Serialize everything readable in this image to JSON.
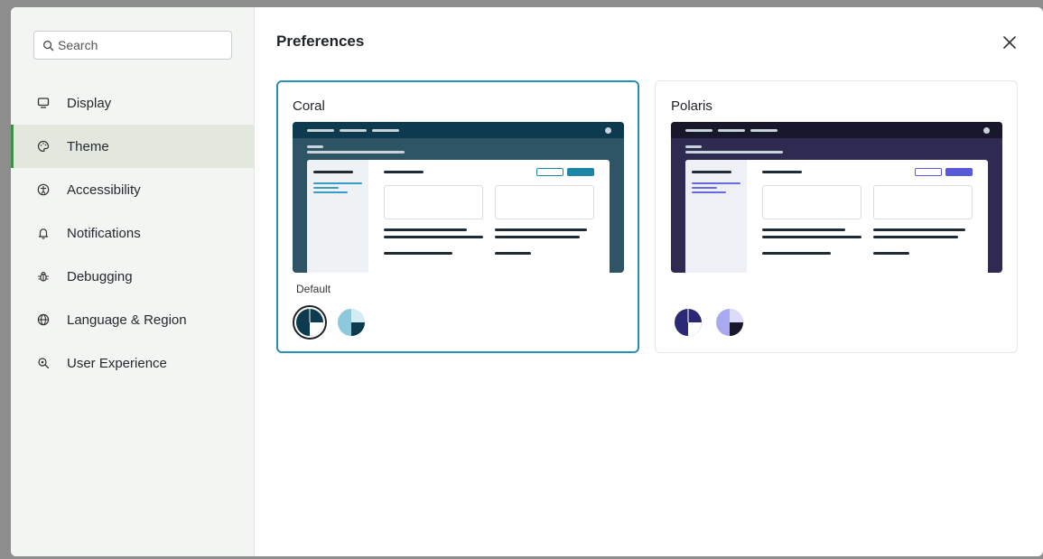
{
  "search": {
    "placeholder": "Search"
  },
  "sidebar": {
    "items": [
      {
        "label": "Display",
        "icon": "monitor-icon"
      },
      {
        "label": "Theme",
        "icon": "palette-icon",
        "active": true
      },
      {
        "label": "Accessibility",
        "icon": "accessibility-icon"
      },
      {
        "label": "Notifications",
        "icon": "bell-icon"
      },
      {
        "label": "Debugging",
        "icon": "bug-icon"
      },
      {
        "label": "Language & Region",
        "icon": "globe-icon"
      },
      {
        "label": "User Experience",
        "icon": "user-experience-icon"
      }
    ]
  },
  "main": {
    "title": "Preferences",
    "close_icon": "close-icon",
    "themes": [
      {
        "name": "Coral",
        "selected": true,
        "default_label": "Default",
        "colors": {
          "header": "#0d3a4f",
          "body": "#2d5566",
          "accent": "#1b86a6",
          "side": "#eef2f4",
          "link": "#3a9cc4"
        },
        "swatches": [
          "dark",
          "light"
        ],
        "active_swatch": "dark"
      },
      {
        "name": "Polaris",
        "selected": false,
        "colors": {
          "header": "#19172c",
          "body": "#2f2a52",
          "accent": "#5a5ad8",
          "side": "#eff0f6",
          "link": "#6a6ae0"
        },
        "swatches": [
          "dark",
          "light"
        ]
      }
    ]
  },
  "colors": {
    "sidebar_active_accent": "#3f8f4a",
    "selected_border": "#2a8fb8"
  }
}
